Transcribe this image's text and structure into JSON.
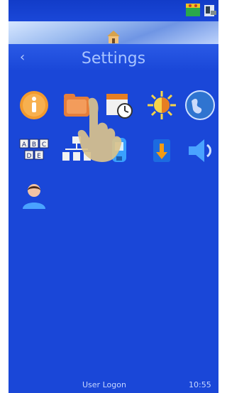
{
  "header": {
    "title": "Settings"
  },
  "footer": {
    "user_logon": "User Logon",
    "time": "10:55"
  },
  "icons": [
    "info-icon",
    "folder-icon",
    "calendar-clock-icon",
    "brightness-icon",
    "globe-icon",
    "keyboard-abc-icon",
    "network-icon",
    "scanner-icon",
    "download-icon",
    "speaker-icon",
    "user-icon"
  ],
  "colors": {
    "background": "#1a47d8",
    "title_text": "#a8c4ff"
  }
}
